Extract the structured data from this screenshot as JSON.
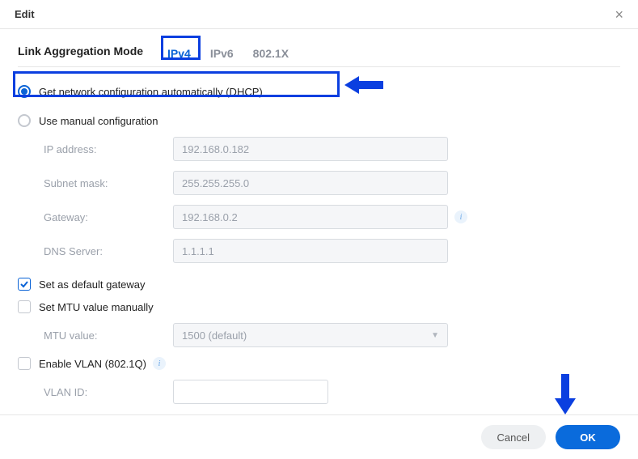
{
  "dialog": {
    "title": "Edit"
  },
  "tabs": {
    "leading_label": "Link Aggregation Mode",
    "items": [
      "IPv4",
      "IPv6",
      "802.1X"
    ],
    "active_index": 0
  },
  "config_mode": {
    "auto_label": "Get network configuration automatically (DHCP)",
    "manual_label": "Use manual configuration",
    "selected": "auto"
  },
  "fields": {
    "ip_label": "IP address:",
    "ip_value": "192.168.0.182",
    "subnet_label": "Subnet mask:",
    "subnet_value": "255.255.255.0",
    "gateway_label": "Gateway:",
    "gateway_value": "192.168.0.2",
    "dns_label": "DNS Server:",
    "dns_value": "1.1.1.1"
  },
  "toggles": {
    "default_gw_label": "Set as default gateway",
    "default_gw_checked": true,
    "mtu_manual_label": "Set MTU value manually",
    "mtu_manual_checked": false,
    "mtu_value_label": "MTU value:",
    "mtu_value_selected": "1500 (default)",
    "vlan_enable_label": "Enable VLAN (802.1Q)",
    "vlan_enable_checked": false,
    "vlan_id_label": "VLAN ID:",
    "vlan_id_value": ""
  },
  "footer": {
    "cancel_label": "Cancel",
    "ok_label": "OK"
  },
  "annotation_color": "#0b3fe0"
}
